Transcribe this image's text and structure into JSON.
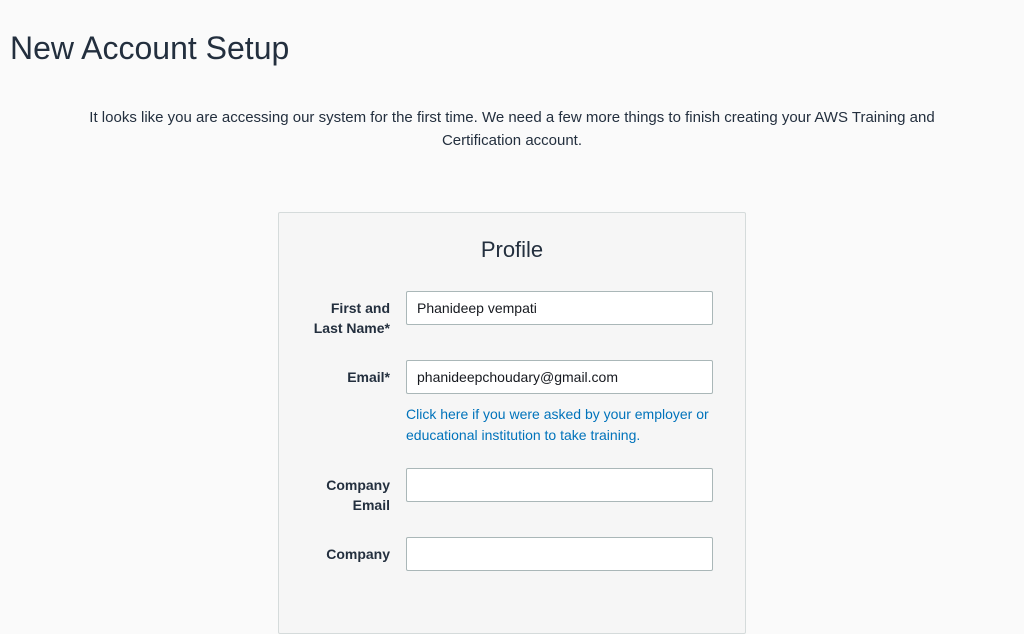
{
  "page": {
    "title": "New Account Setup",
    "intro": "It looks like you are accessing our system for the first time. We need a few more things to finish creating your AWS Training and Certification account."
  },
  "profile": {
    "heading": "Profile",
    "fields": {
      "name": {
        "label": "First and Last Name*",
        "value": "Phanideep vempati"
      },
      "email": {
        "label": "Email*",
        "value": "phanideepchoudary@gmail.com",
        "help_link": "Click here if you were asked by your employer or educational institution to take training."
      },
      "company_email": {
        "label": "Company Email",
        "value": ""
      },
      "company": {
        "label": "Company",
        "value": ""
      }
    }
  }
}
